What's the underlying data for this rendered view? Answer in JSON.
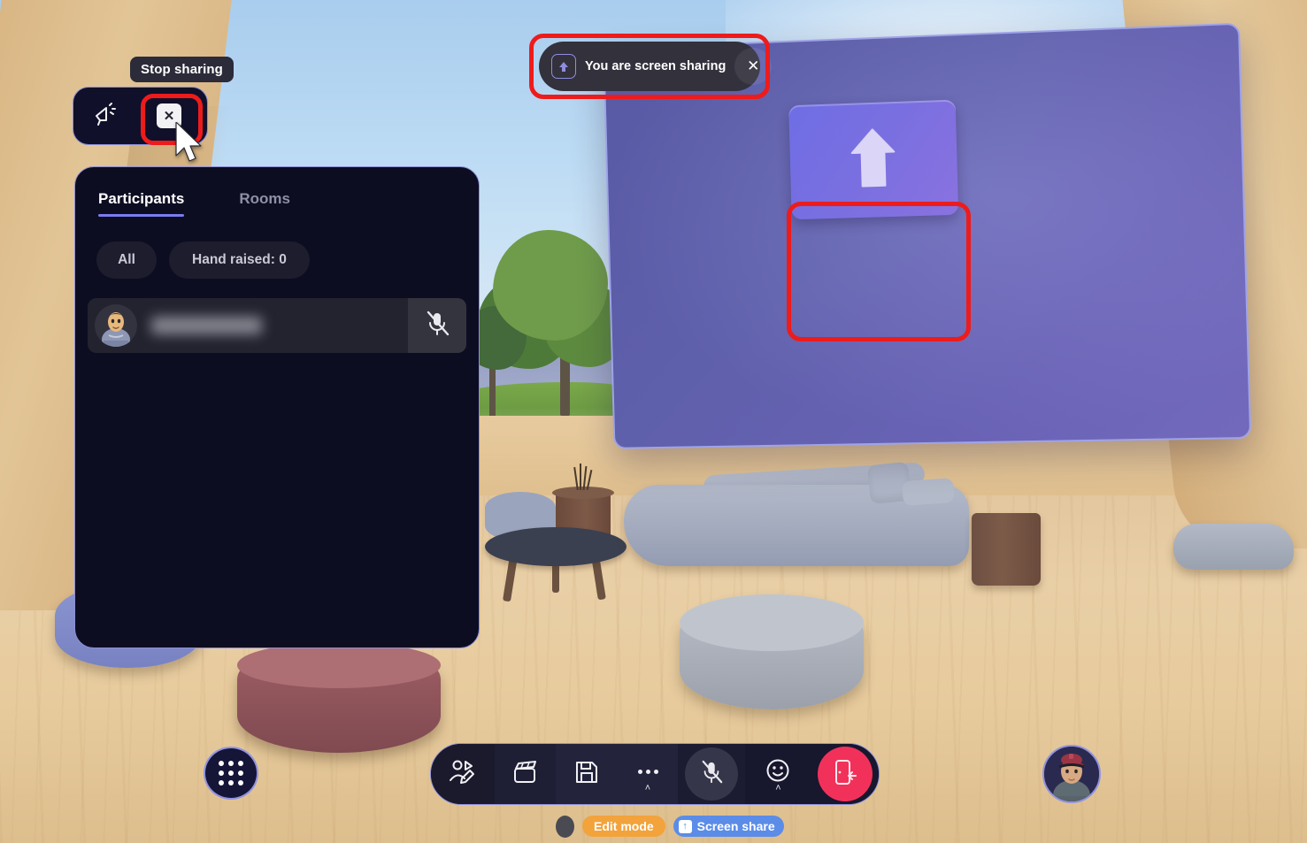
{
  "tooltip": {
    "text": "Stop sharing"
  },
  "mini_bar": {
    "announce_icon": "megaphone-icon",
    "close_label": "✕"
  },
  "banner": {
    "icon": "screen-share-up-arrow-icon",
    "text": "You are screen sharing",
    "close_label": "✕"
  },
  "screen": {
    "placeholder_icon": "upload-arrow-icon"
  },
  "panel": {
    "tabs": [
      {
        "label": "Participants",
        "active": true
      },
      {
        "label": "Rooms",
        "active": false
      }
    ],
    "chips": [
      {
        "label": "All"
      },
      {
        "label": "Hand raised: 0"
      }
    ],
    "participants": [
      {
        "name": "",
        "name_redacted": true,
        "mic": "mic-muted-icon"
      }
    ]
  },
  "toolbar": {
    "items": [
      {
        "name": "edit-avatar",
        "icon": "avatar-pencil-icon",
        "label": ""
      },
      {
        "name": "media",
        "icon": "clapperboard-icon",
        "label": ""
      },
      {
        "name": "save",
        "icon": "floppy-disk-icon",
        "label": ""
      },
      {
        "name": "more",
        "icon": "ellipsis-icon",
        "label": "",
        "chevron": "˄"
      },
      {
        "name": "microphone",
        "icon": "mic-muted-icon",
        "label": ""
      },
      {
        "name": "reactions",
        "icon": "smiley-icon",
        "label": "",
        "chevron": "˄"
      },
      {
        "name": "leave",
        "icon": "leave-door-icon",
        "label": ""
      }
    ]
  },
  "grid_button": {
    "icon": "apps-grid-icon"
  },
  "user_avatar": {
    "icon": "user-avatar"
  },
  "badges": {
    "edit_mode": "Edit mode",
    "screen_share": "Screen share",
    "screen_share_icon": "↑"
  },
  "colors": {
    "accent_purple": "#7b7cf0",
    "panel_bg": "#0d0d22",
    "annotation_red": "#ee1b1b",
    "leave_red": "#f2315a",
    "edit_mode_orange": "#f2a33c",
    "screen_share_blue": "#5b8ce8",
    "screen_purple": "#6566b6"
  }
}
